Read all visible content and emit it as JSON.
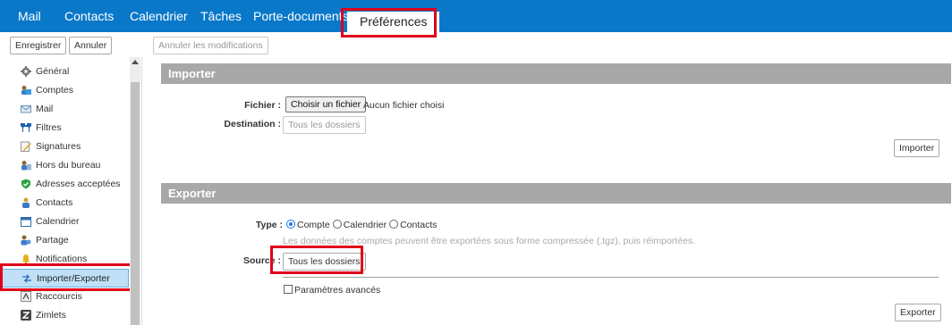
{
  "nav": {
    "tabs": [
      {
        "label": "Mail"
      },
      {
        "label": "Contacts"
      },
      {
        "label": "Calendrier"
      },
      {
        "label": "Tâches"
      },
      {
        "label": "Porte-documents"
      },
      {
        "label": "Préférences",
        "active": true
      }
    ]
  },
  "toolbar": {
    "save_label": "Enregistrer",
    "cancel_label": "Annuler",
    "revert_label": "Annuler les modifications"
  },
  "sidebar": {
    "items": [
      {
        "label": "Général",
        "icon": "gear-icon"
      },
      {
        "label": "Comptes",
        "icon": "accounts-icon"
      },
      {
        "label": "Mail",
        "icon": "envelope-icon"
      },
      {
        "label": "Filtres",
        "icon": "filter-icon"
      },
      {
        "label": "Signatures",
        "icon": "pen-icon"
      },
      {
        "label": "Hors du bureau",
        "icon": "out-of-office-icon"
      },
      {
        "label": "Adresses acceptées",
        "icon": "shield-check-icon"
      },
      {
        "label": "Contacts",
        "icon": "contact-icon"
      },
      {
        "label": "Calendrier",
        "icon": "calendar-icon"
      },
      {
        "label": "Partage",
        "icon": "sharing-icon"
      },
      {
        "label": "Notifications",
        "icon": "bell-icon"
      },
      {
        "label": "Importer/Exporter",
        "icon": "import-export-icon",
        "selected": true
      },
      {
        "label": "Raccourcis",
        "icon": "keyboard-shortcut-icon"
      },
      {
        "label": "Zimlets",
        "icon": "zimlet-icon"
      }
    ]
  },
  "import": {
    "header": "Importer",
    "file_label": "Fichier :",
    "choose_file_label": "Choisir un fichier",
    "no_file_text": "Aucun fichier choisi",
    "destination_label": "Destination :",
    "destination_value": "Tous les dossiers",
    "import_button_label": "Importer"
  },
  "export": {
    "header": "Exporter",
    "type_label": "Type :",
    "types": [
      "Compte",
      "Calendrier",
      "Contacts"
    ],
    "selected_type": "Compte",
    "hint": "Les données des comptes peuvent être exportées sous forme compressée (.tgz), puis réimportées.",
    "source_label": "Source :",
    "source_value": "Tous les dossiers",
    "advanced_label": "Paramètres avancés",
    "export_button_label": "Exporter"
  },
  "colors": {
    "topbar": "#0a78c8",
    "highlight_box": "#e0001b",
    "section_header": "#a8a8a8",
    "selected_item": "#bfe0f7"
  }
}
